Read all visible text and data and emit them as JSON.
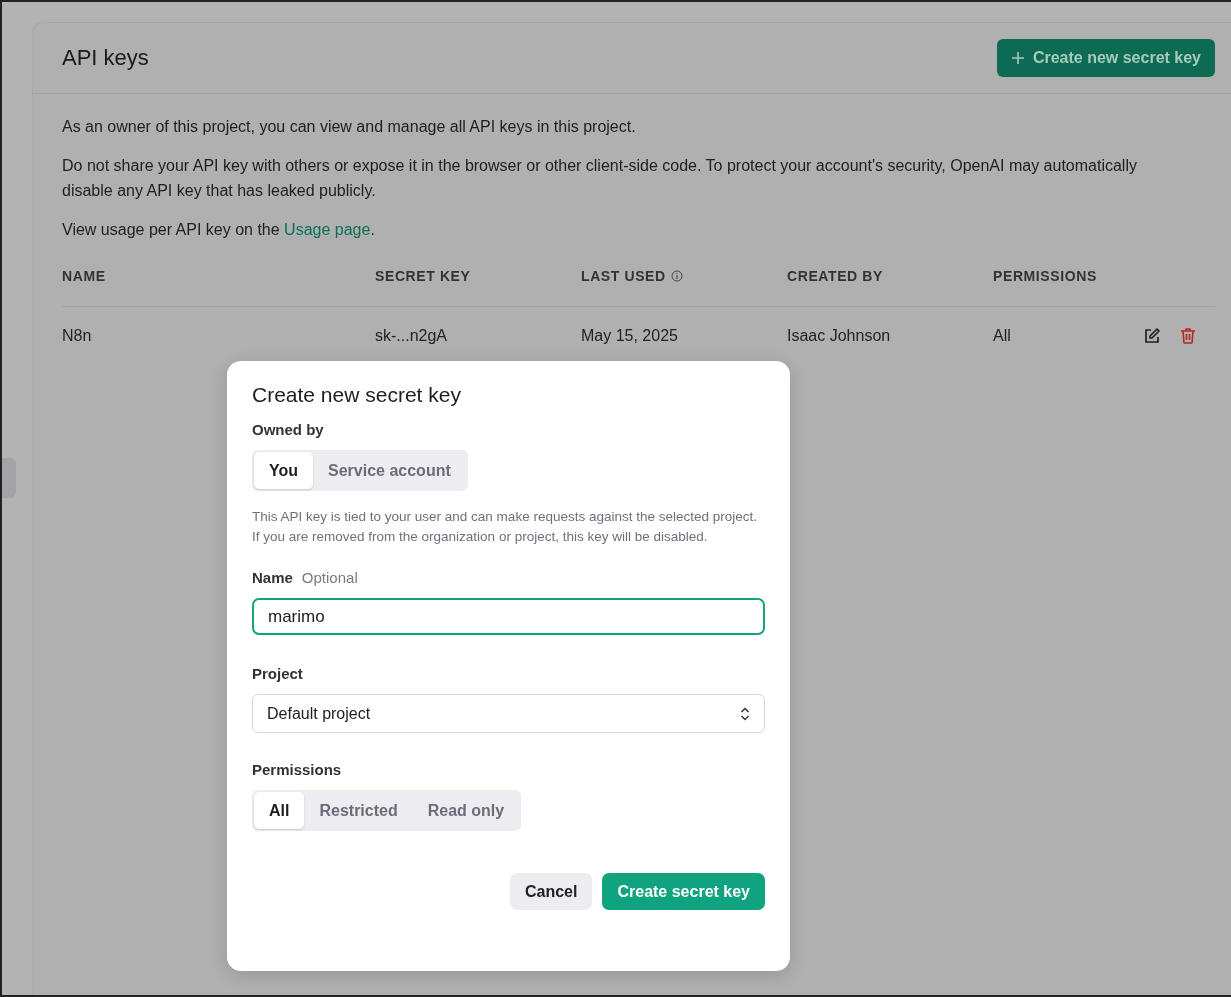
{
  "page": {
    "title": "API keys",
    "create_button": "Create new secret key",
    "paragraphs": [
      "As an owner of this project, you can view and manage all API keys in this project.",
      "Do not share your API key with others or expose it in the browser or other client-side code. To protect your account's security, OpenAI may automatically disable any API key that has leaked publicly."
    ],
    "usage_text": "View usage per API key on the ",
    "usage_link": "Usage page",
    "usage_end": "."
  },
  "table": {
    "columns": [
      "NAME",
      "SECRET KEY",
      "LAST USED",
      "CREATED BY",
      "PERMISSIONS"
    ],
    "rows": [
      {
        "name": "N8n",
        "secret_key": "sk-...n2gA",
        "last_used": "May 15, 2025",
        "created_by": "Isaac Johnson",
        "permissions": "All"
      }
    ]
  },
  "dialog": {
    "title": "Create new secret key",
    "owned_by_label": "Owned by",
    "owner_options": [
      {
        "label": "You",
        "selected": true
      },
      {
        "label": "Service account",
        "selected": false
      }
    ],
    "owner_note": "This API key is tied to your user and can make requests against the selected project. If you are removed from the organization or project, this key will be disabled.",
    "name_label": "Name",
    "name_hint": "Optional",
    "name_value": "marimo",
    "project_label": "Project",
    "project_value": "Default project",
    "permissions_label": "Permissions",
    "permission_options": [
      {
        "label": "All",
        "selected": true
      },
      {
        "label": "Restricted",
        "selected": false
      },
      {
        "label": "Read only",
        "selected": false
      }
    ],
    "buttons": [
      {
        "label": "Cancel",
        "kind": "secondary"
      },
      {
        "label": "Create secret key",
        "kind": "primary"
      }
    ]
  }
}
